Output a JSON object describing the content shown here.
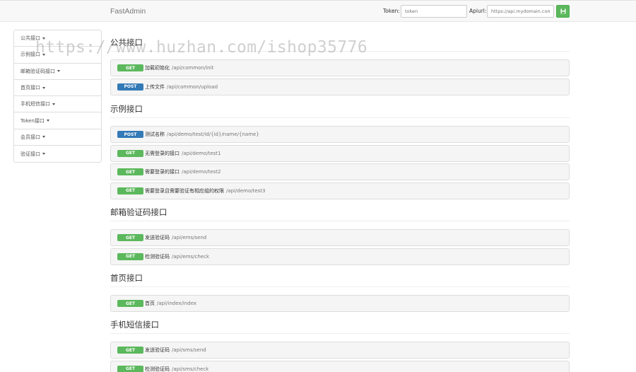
{
  "navbar": {
    "brand": "FastAdmin",
    "token_label": "Token:",
    "token_placeholder": "token",
    "apiurl_label": "Apiurl:",
    "apiurl_placeholder": "https://api.mydomain.com",
    "save_icon": "save-icon",
    "accent_color": "#5cb85c"
  },
  "sidebar": {
    "items": [
      {
        "label": "公共接口"
      },
      {
        "label": "示例接口"
      },
      {
        "label": "邮箱验证码接口"
      },
      {
        "label": "首页接口"
      },
      {
        "label": "手机短信接口"
      },
      {
        "label": "Token接口"
      },
      {
        "label": "会员接口"
      },
      {
        "label": "验证接口"
      }
    ]
  },
  "sections": [
    {
      "title": "公共接口",
      "rows": [
        {
          "method": "GET",
          "title": "加载初始化",
          "path": "/api/common/init"
        },
        {
          "method": "POST",
          "title": "上传文件",
          "path": "/api/common/upload"
        }
      ]
    },
    {
      "title": "示例接口",
      "rows": [
        {
          "method": "POST",
          "title": "测试名称",
          "path": "/api/demo/test/id/{id}/name/{name}"
        },
        {
          "method": "GET",
          "title": "无需登录的接口",
          "path": "/api/demo/test1"
        },
        {
          "method": "GET",
          "title": "需要登录的接口",
          "path": "/api/demo/test2"
        },
        {
          "method": "GET",
          "title": "需要登录且需要验证有相应组的权限",
          "path": "/api/demo/test3"
        }
      ]
    },
    {
      "title": "邮箱验证码接口",
      "rows": [
        {
          "method": "GET",
          "title": "发送验证码",
          "path": "/api/ems/send"
        },
        {
          "method": "GET",
          "title": "检测验证码",
          "path": "/api/ems/check"
        }
      ]
    },
    {
      "title": "首页接口",
      "rows": [
        {
          "method": "GET",
          "title": "首页",
          "path": "/api/index/index"
        }
      ]
    },
    {
      "title": "手机短信接口",
      "rows": [
        {
          "method": "GET",
          "title": "发送验证码",
          "path": "/api/sms/send"
        },
        {
          "method": "GET",
          "title": "检测验证码",
          "path": "/api/sms/check"
        }
      ]
    }
  ],
  "colors": {
    "get": "#5cb85c",
    "post": "#337ab7"
  },
  "watermark": "https://www.huzhan.com/ishop35776"
}
